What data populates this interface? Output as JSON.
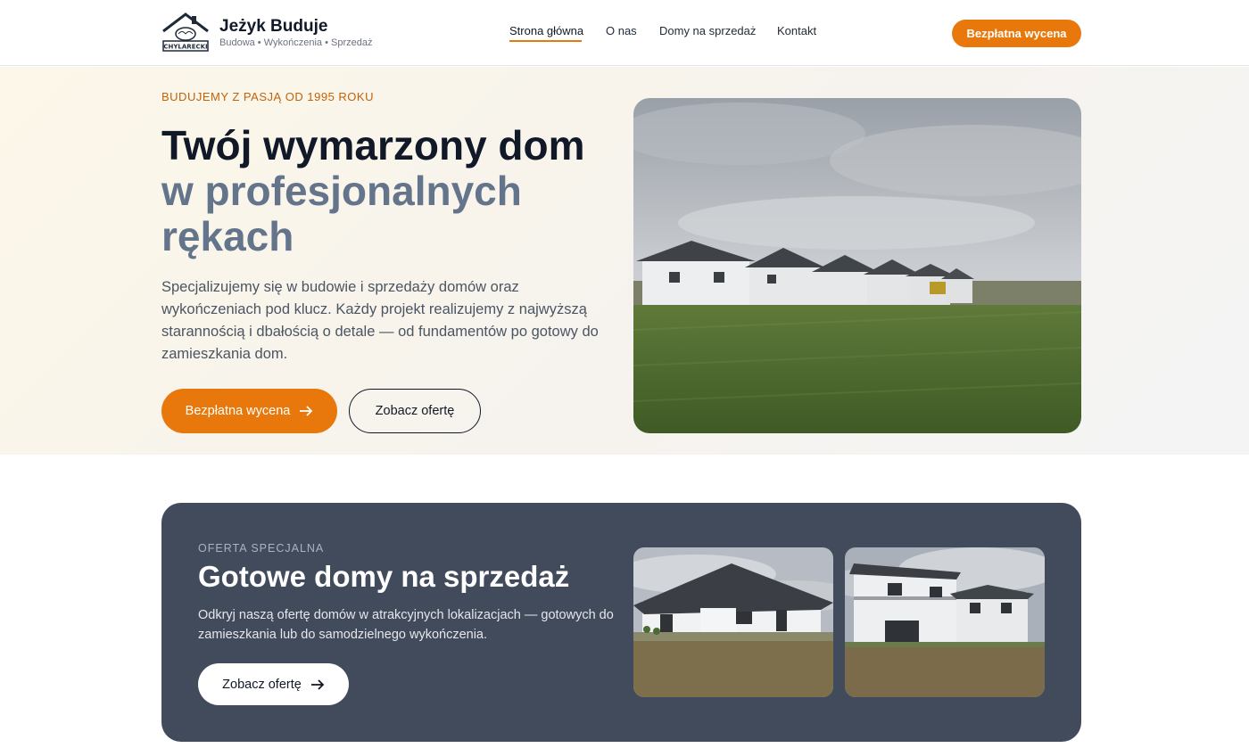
{
  "header": {
    "brand_name": "Jeżyk Buduje",
    "brand_tagline": "Budowa • Wykończenia • Sprzedaż",
    "logo_text": "CHYLARECKI",
    "nav": [
      {
        "label": "Strona główna",
        "active": true
      },
      {
        "label": "O nas",
        "active": false
      },
      {
        "label": "Domy na sprzedaż",
        "active": false
      },
      {
        "label": "Kontakt",
        "active": false
      }
    ],
    "cta_label": "Bezpłatna wycena"
  },
  "hero": {
    "eyebrow": "BUDUJEMY Z PASJĄ OD 1995 ROKU",
    "title_line1": "Twój wymarzony dom",
    "title_line2": "w profesjonalnych",
    "title_line3": "rękach",
    "description": "Specjalizujemy się w budowie i sprzedaży domów oraz wykończeniach pod klucz. Każdy projekt realizujemy z najwyższą starannością i dbałością o detale — od fundamentów po gotowy do zamieszkania dom.",
    "primary_button": "Bezpłatna wycena",
    "secondary_button": "Zobacz ofertę",
    "image": "houses-row-field-photo"
  },
  "offer": {
    "eyebrow": "OFERTA SPECJALNA",
    "title": "Gotowe domy na sprzedaż",
    "description": "Odkryj naszą ofertę domów w atrakcyjnych lokalizacjach — gotowych do zamieszkania lub do samodzielnego wykończenia.",
    "button": "Zobacz ofertę",
    "images": [
      "single-storey-house-photo",
      "two-storey-house-photo"
    ]
  },
  "colors": {
    "accent": "#e8780b",
    "offer_bg": "#414b5c",
    "title_gray": "#64748b"
  }
}
